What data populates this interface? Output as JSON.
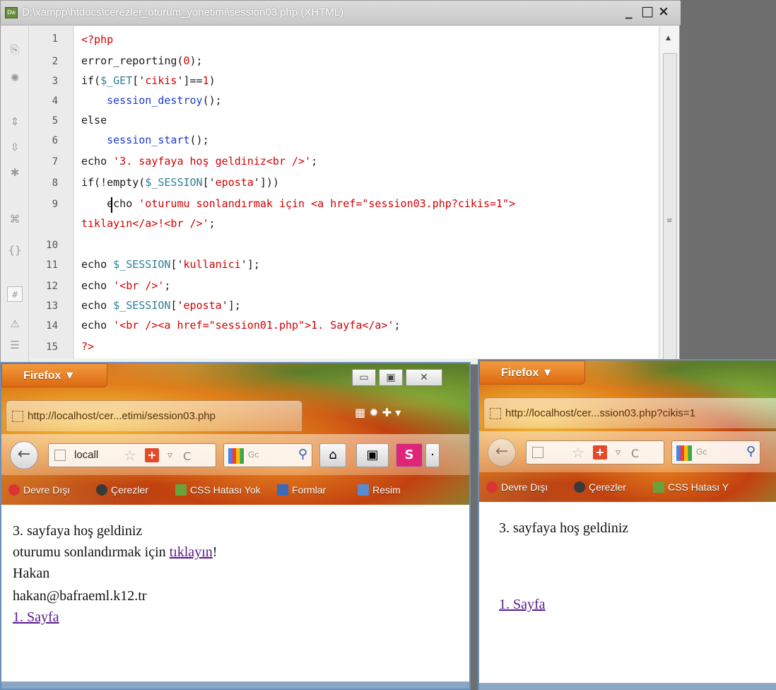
{
  "editor": {
    "title": "D:\\xampp\\htdocs\\cerezler_oturum_yonetimi\\session03.php (XHTML)",
    "icon_label": "Dw",
    "window_controls": [
      "_",
      "□",
      "×"
    ],
    "line_numbers": [
      "1",
      "2",
      "3",
      "4",
      "5",
      "6",
      "7",
      "8",
      "9",
      "10",
      "11",
      "12",
      "13",
      "14",
      "15"
    ],
    "code": {
      "l1": "<?php",
      "l2a": "error_reporting(",
      "l2b": "0",
      "l2c": ");",
      "l3a": "if(",
      "l3b": "$_GET",
      "l3c": "['",
      "l3d": "cikis",
      "l3e": "']==",
      "l3f": "1",
      "l3g": ")",
      "l4a": "    ",
      "l4b": "session_destroy",
      "l4c": "();",
      "l5": "else",
      "l6a": "    ",
      "l6b": "session_start",
      "l6c": "();",
      "l7a": "echo ",
      "l7b": "'3. sayfaya hoş geldiniz<br />'",
      "l7c": ";",
      "l8a": "if(!empty(",
      "l8b": "$_SESSION",
      "l8c": "['",
      "l8d": "eposta",
      "l8e": "']))",
      "l9a": "    echo ",
      "l9b": "'oturumu sonlandırmak için <a href=\"session03.php?cikis=1\">",
      "l9cont": "tıklayın</a>!<br />'",
      "l9end": ";",
      "l11a": "echo ",
      "l11b": "$_SESSION",
      "l11c": "['",
      "l11d": "kullanici",
      "l11e": "'];",
      "l12a": "echo ",
      "l12b": "'<br />'",
      "l12c": ";",
      "l13a": "echo ",
      "l13b": "$_SESSION",
      "l13c": "['",
      "l13d": "eposta",
      "l13e": "'];",
      "l14a": "echo ",
      "l14b": "'<br /><a href=\"session01.php\">1. Sayfa</a>'",
      "l14c": ";",
      "l15": "?>"
    }
  },
  "firefox_left": {
    "menu_label": "Firefox ▼",
    "tab_title": "http://localhost/cer...etimi/session03.php",
    "url_text": "locall",
    "search_text": "Gc",
    "bookmarks": [
      "Devre Dışı",
      "Çerezler",
      "CSS Hatası Yok",
      "Formlar",
      "Resim"
    ],
    "content": {
      "line1": "3. sayfaya hoş geldiniz",
      "line2_prefix": "oturumu sonlandırmak için ",
      "line2_link": "tıklayın",
      "line2_suffix": "!",
      "line3": "Hakan",
      "line4": "hakan@bafraeml.k12.tr",
      "line5_link": "1. Sayfa"
    }
  },
  "firefox_right": {
    "menu_label": "Firefox ▼",
    "tab_title": "http://localhost/cer...ssion03.php?cikis=1",
    "search_text": "Gc",
    "bookmarks": [
      "Devre Dışı",
      "Çerezler",
      "CSS Hatası Y"
    ],
    "content": {
      "line1": "3. sayfaya hoş geldiniz",
      "line2_link": "1. Sayfa"
    }
  }
}
